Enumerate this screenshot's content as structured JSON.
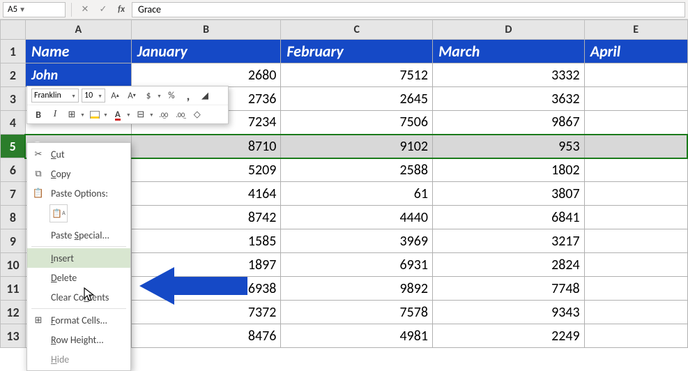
{
  "formula_bar": {
    "name_box": "A5",
    "value": "Grace"
  },
  "columns": [
    "A",
    "B",
    "C",
    "D",
    "E"
  ],
  "rows": [
    "1",
    "2",
    "3",
    "4",
    "5",
    "6",
    "7",
    "8",
    "9",
    "10",
    "11",
    "12",
    "13"
  ],
  "selected_row": "5",
  "headers": {
    "A": "Name",
    "B": "January",
    "C": "February",
    "D": "March",
    "E": "April"
  },
  "data": {
    "r2": {
      "A": "John",
      "B": "2680",
      "C": "7512",
      "D": "3332",
      "E": ""
    },
    "r3": {
      "B": "2736",
      "C": "2645",
      "D": "3632",
      "E": ""
    },
    "r4": {
      "B": "7234",
      "C": "7506",
      "D": "9867",
      "E": ""
    },
    "r5": {
      "A": "Grace",
      "B": "8710",
      "C": "9102",
      "D": "953",
      "E": ""
    },
    "r6": {
      "B": "5209",
      "C": "2588",
      "D": "1802",
      "E": ""
    },
    "r7": {
      "B": "4164",
      "C": "61",
      "D": "3807",
      "E": ""
    },
    "r8": {
      "B": "8742",
      "C": "4440",
      "D": "6841",
      "E": ""
    },
    "r9": {
      "B": "1585",
      "C": "3969",
      "D": "3217",
      "E": ""
    },
    "r10": {
      "B": "1897",
      "C": "6931",
      "D": "2824",
      "E": ""
    },
    "r11": {
      "B": "6938",
      "C": "9892",
      "D": "7748",
      "E": ""
    },
    "r12": {
      "B": "7372",
      "C": "7578",
      "D": "9343",
      "E": ""
    },
    "r13": {
      "B": "8476",
      "C": "4981",
      "D": "2249",
      "E": ""
    }
  },
  "mini_toolbar": {
    "font": "Franklin",
    "size": "10",
    "grow": "A^",
    "shrink": "A˅",
    "dollar": "$",
    "percent": "%",
    "comma": ",",
    "bold": "B",
    "italic": "I",
    "decimals_more": ".00→.0",
    "decimals_less": ".0→.00"
  },
  "context_menu": {
    "cut": "Cut",
    "copy": "Copy",
    "paste_options": "Paste Options:",
    "paste_special": "Paste Special...",
    "insert": "Insert",
    "delete": "Delete",
    "clear": "Clear Contents",
    "format": "Format Cells...",
    "row_height": "Row Height...",
    "hide": "Hide"
  }
}
